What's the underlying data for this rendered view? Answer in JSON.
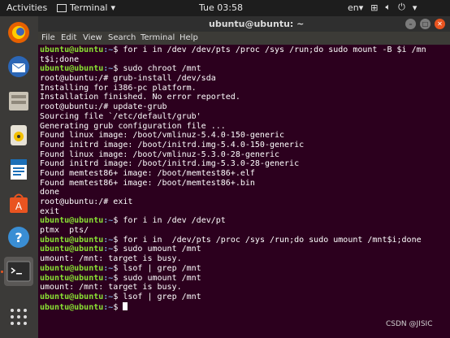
{
  "topbar": {
    "activities": "Activities",
    "app_menu": "Terminal",
    "clock": "Tue 03:58",
    "lang": "en"
  },
  "window": {
    "title": "ubuntu@ubuntu: ~"
  },
  "menu": [
    "File",
    "Edit",
    "View",
    "Search",
    "Terminal",
    "Help"
  ],
  "terminal_lines": [
    {
      "user": "ubuntu@ubuntu",
      "path": ":~",
      "text": "$ for i in /dev /dev/pts /proc /sys /run;do sudo mount -B $i /mn"
    },
    {
      "text": "t$i;done"
    },
    {
      "user": "ubuntu@ubuntu",
      "path": ":~",
      "text": "$ sudo chroot /mnt"
    },
    {
      "text": "root@ubuntu:/# grub-install /dev/sda"
    },
    {
      "text": "Installing for i386-pc platform."
    },
    {
      "text": "Installation finished. No error reported."
    },
    {
      "text": "root@ubuntu:/# update-grub"
    },
    {
      "text": "Sourcing file `/etc/default/grub'"
    },
    {
      "text": "Generating grub configuration file ..."
    },
    {
      "text": "Found linux image: /boot/vmlinuz-5.4.0-150-generic"
    },
    {
      "text": "Found initrd image: /boot/initrd.img-5.4.0-150-generic"
    },
    {
      "text": "Found linux image: /boot/vmlinuz-5.3.0-28-generic"
    },
    {
      "text": "Found initrd image: /boot/initrd.img-5.3.0-28-generic"
    },
    {
      "text": "Found memtest86+ image: /boot/memtest86+.elf"
    },
    {
      "text": "Found memtest86+ image: /boot/memtest86+.bin"
    },
    {
      "text": "done"
    },
    {
      "text": "root@ubuntu:/# exit"
    },
    {
      "text": "exit"
    },
    {
      "user": "ubuntu@ubuntu",
      "path": ":~",
      "text": "$ for i in /dev /dev/pt"
    },
    {
      "text": "ptmx  pts/"
    },
    {
      "user": "ubuntu@ubuntu",
      "path": ":~",
      "text": "$ for i in  /dev/pts /proc /sys /run;do sudo umount /mnt$i;done"
    },
    {
      "user": "ubuntu@ubuntu",
      "path": ":~",
      "text": "$ sudo umount /mnt"
    },
    {
      "text": "umount: /mnt: target is busy."
    },
    {
      "user": "ubuntu@ubuntu",
      "path": ":~",
      "text": "$ lsof | grep /mnt"
    },
    {
      "user": "ubuntu@ubuntu",
      "path": ":~",
      "text": "$ sudo umount /mnt"
    },
    {
      "text": "umount: /mnt: target is busy."
    },
    {
      "user": "ubuntu@ubuntu",
      "path": ":~",
      "text": "$ lsof | grep /mnt"
    },
    {
      "user": "ubuntu@ubuntu",
      "path": ":~",
      "text": "$ ",
      "cursor": true
    }
  ],
  "watermark": "CSDN @JISIC",
  "dock_items": [
    "firefox-icon",
    "thunderbird-icon",
    "files-icon",
    "rhythmbox-icon",
    "writer-icon",
    "software-icon",
    "help-icon",
    "terminal-icon",
    "apps-grid-icon"
  ]
}
